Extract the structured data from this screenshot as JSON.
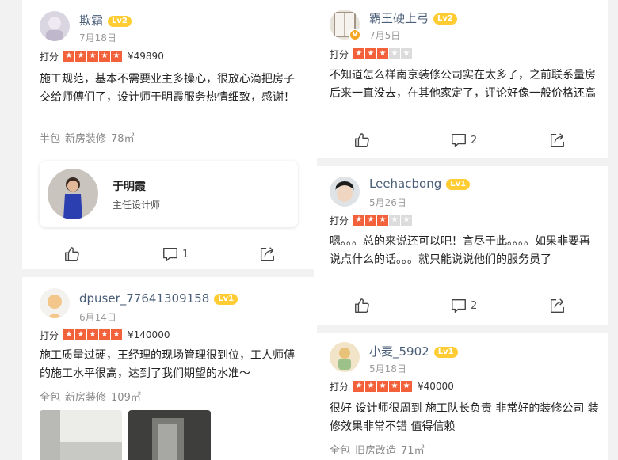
{
  "rating_label": "打分",
  "reviews_left": [
    {
      "username": "欺霜",
      "level": "Lv2",
      "date": "7月18日",
      "stars": 5,
      "price": "¥49890",
      "text": "施工规范，基本不需要业主多操心，很放心滴把房子交给师傅们了，设计师于明霞服务热情细致，感谢！",
      "meta": [
        "半包",
        "新房装修",
        "78㎡"
      ],
      "designer": {
        "name": "于明霞",
        "role": "主任设计师"
      },
      "comments": "1"
    },
    {
      "username": "dpuser_77641309158",
      "level": "Lv1",
      "date": "6月14日",
      "stars": 5,
      "price": "¥140000",
      "text": "施工质量过硬，王经理的现场管理很到位，工人师傅的施工水平很高，达到了我们期望的水准～",
      "meta": [
        "全包",
        "新房装修",
        "109㎡"
      ]
    }
  ],
  "reviews_right": [
    {
      "username": "霸王硬上弓",
      "level": "Lv2",
      "date": "7月5日",
      "stars": 3,
      "text": "不知道怎么样南京装修公司实在太多了，之前联系量房后来一直没去，在其他家定了，评论好像一般价格还高",
      "comments": "2"
    },
    {
      "username": "Leehacbong",
      "level": "Lv1",
      "date": "5月26日",
      "stars": 3,
      "text": "嗯。。。总的来说还可以吧！言尽于此。。。。如果非要再说点什么的话。。。就只能说说他们的服务员了",
      "comments": "2"
    },
    {
      "username": "小麦_5902",
      "level": "Lv1",
      "date": "5月18日",
      "stars": 5,
      "price": "¥40000",
      "text": "很好  设计师很周到  施工队长负责  非常好的装修公司  装修效果非常不错  值得信赖",
      "meta": [
        "全包",
        "旧房改造",
        "71㎡"
      ]
    }
  ],
  "colors": {
    "star_on": "#f2613a",
    "star_off": "#dcdcdc",
    "level_badge": "#ffcc33",
    "username": "#4a5e78"
  },
  "icons": [
    "like-icon",
    "comment-icon",
    "share-icon"
  ]
}
